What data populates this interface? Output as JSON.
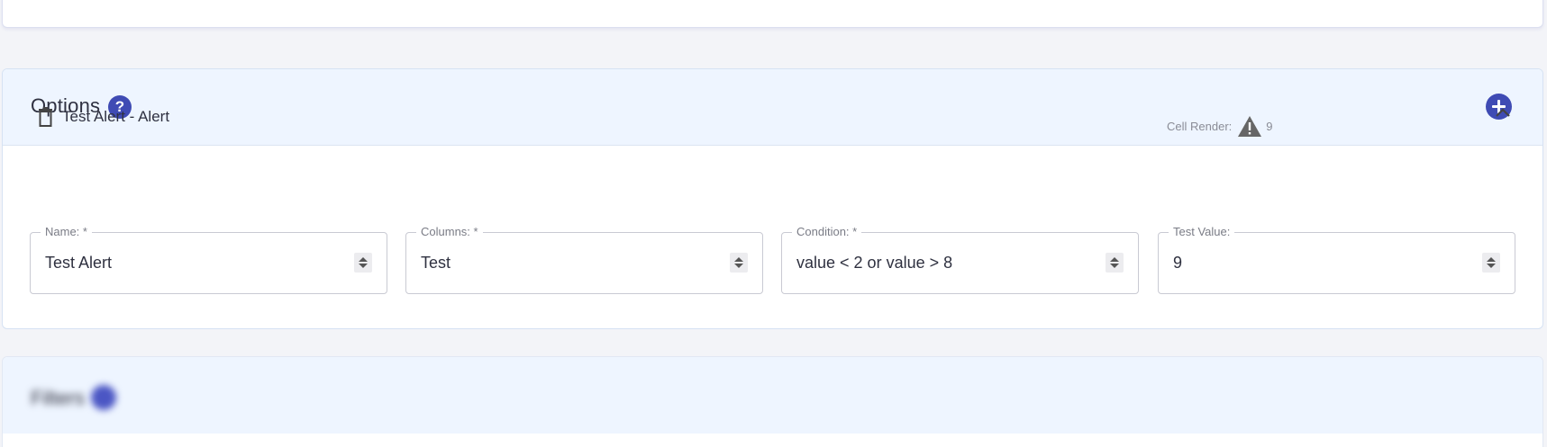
{
  "options": {
    "title": "Options",
    "help_glyph": "?",
    "alert": {
      "title": "Test Alert - Alert",
      "cell_render_label": "Cell Render:",
      "cell_render_value": "9",
      "fields": [
        {
          "label": "Name: *",
          "value": "Test Alert"
        },
        {
          "label": "Columns: *",
          "value": "Test"
        },
        {
          "label": "Condition: *",
          "value": "value < 2 or value > 8"
        },
        {
          "label": "Test Value:",
          "value": "9"
        }
      ]
    }
  },
  "filters": {
    "title": "Filters"
  },
  "colors": {
    "accent": "#3f4bb4",
    "header_bg": "#eef5ff",
    "page_bg": "#f3f4f8"
  },
  "icons": [
    "help-icon",
    "add-icon",
    "trash-icon",
    "warning-icon",
    "chevron-up-icon"
  ]
}
